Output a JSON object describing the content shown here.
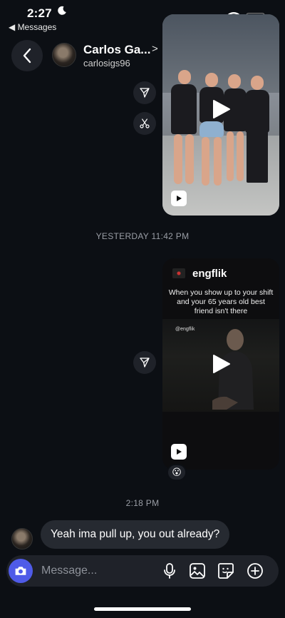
{
  "status_bar": {
    "time": "2:27",
    "back_app": "◀ Messages"
  },
  "header": {
    "name": "Carlos Ga...",
    "name_chevron": ">",
    "username": "carlosigs96"
  },
  "messages": {
    "timestamp_1": "YESTERDAY 11:42 PM",
    "reel_2": {
      "account": "engflik",
      "caption": "When you show up to your shift and your 65 years old best friend isn't there",
      "watermark": "@engflik",
      "reaction": "😮"
    },
    "timestamp_2": "2:18 PM",
    "incoming_text": "Yeah ima pull up, you out already?"
  },
  "composer": {
    "placeholder": "Message..."
  },
  "colors": {
    "background": "#0c0f14",
    "surface": "#1f2229",
    "bubble": "#262a31",
    "camera_accent": "#4f5be8",
    "battery": "#f5d90a"
  }
}
